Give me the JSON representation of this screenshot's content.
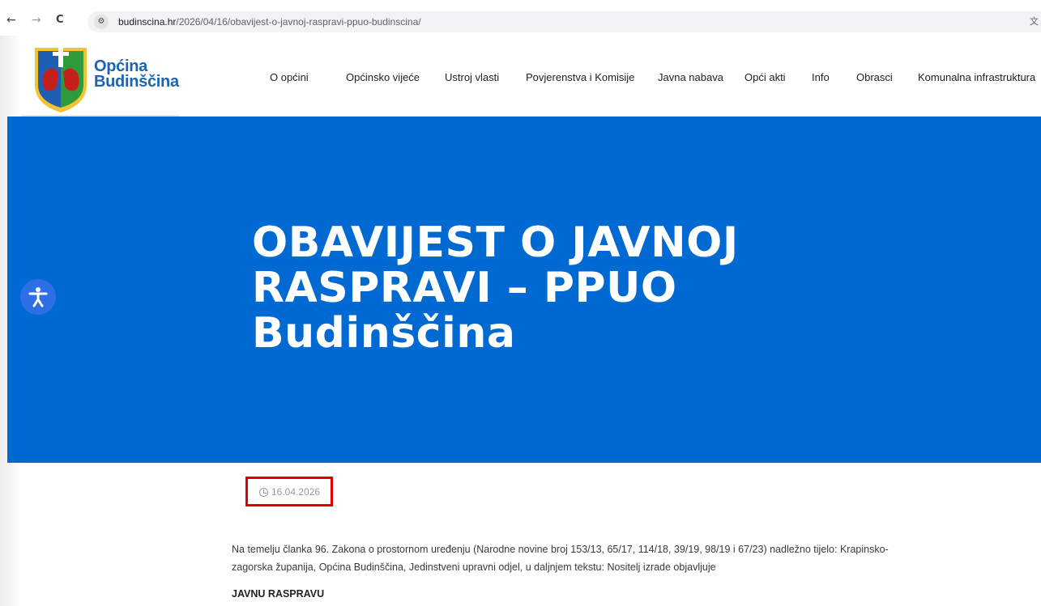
{
  "browser": {
    "url_host": "budinscina.hr",
    "url_path": "/2026/04/16/obavijest-o-javnoj-raspravi-ppuo-budinscina/",
    "back_glyph": "←",
    "forward_glyph": "→",
    "reload_glyph": "C",
    "site_info_glyph": "⚙",
    "translate_glyph": "文"
  },
  "logo": {
    "line1": "Općina",
    "line2": "Budinščina"
  },
  "nav": {
    "items": [
      "O općini",
      "Općinsko vijeće",
      "Ustroj vlasti",
      "Povjerenstva i Komisije",
      "Javna nabava",
      "Opći akti",
      "Info",
      "Obrasci",
      "Komunalna infrastruktura"
    ]
  },
  "post": {
    "title_lines": [
      "OBAVIJEST O JAVNOJ",
      "RASPRAVI – PPUO",
      "Budinščina"
    ],
    "date": "16.04.2026",
    "body_lines": [
      "Na temelju članka 96. Zakona o prostornom uređenju (Narodne novine broj 153/13, 65/17, 114/18, 39/19, 98/19 i 67/23) nadležno tijelo: Krapinsko-",
      "zagorska županija, Općina Budinščina, Jedinstveni upravni odjel, u daljnjem tekstu: Nositelj izrade objavljuje"
    ],
    "subheading": "JAVNU RASPRAVU"
  },
  "colors": {
    "hero_blue": "#0069d2",
    "logo_blue": "#1c63b7",
    "highlight_red": "#e00000",
    "a11y_blue": "#2f6fe6"
  }
}
